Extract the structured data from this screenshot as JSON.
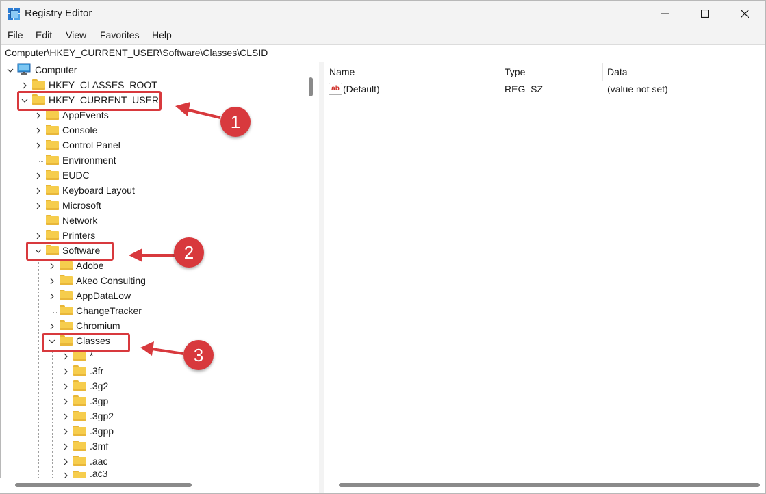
{
  "window": {
    "title": "Registry Editor",
    "minimize_icon": "minimize-icon",
    "maximize_icon": "maximize-icon",
    "close_icon": "close-icon"
  },
  "menu": [
    "File",
    "Edit",
    "View",
    "Favorites",
    "Help"
  ],
  "address": "Computer\\HKEY_CURRENT_USER\\Software\\Classes\\CLSID",
  "tree": {
    "root": "Computer",
    "hkcr": "HKEY_CLASSES_ROOT",
    "hkcu": "HKEY_CURRENT_USER",
    "hkcu_children": [
      "AppEvents",
      "Console",
      "Control Panel",
      "Environment",
      "EUDC",
      "Keyboard Layout",
      "Microsoft",
      "Network",
      "Printers"
    ],
    "software": "Software",
    "software_children": [
      "Adobe",
      "Akeo Consulting",
      "AppDataLow",
      "ChangeTracker",
      "Chromium"
    ],
    "classes": "Classes",
    "classes_children": [
      "*",
      ".3fr",
      ".3g2",
      ".3gp",
      ".3gp2",
      ".3gpp",
      ".3mf",
      ".aac",
      ".ac3"
    ]
  },
  "list": {
    "headers": [
      "Name",
      "Type",
      "Data"
    ],
    "rows": [
      {
        "name": "(Default)",
        "type": "REG_SZ",
        "data": "(value not set)"
      }
    ]
  },
  "annotations": [
    "1",
    "2",
    "3"
  ],
  "colors": {
    "annotation_red": "#d8393d",
    "folder_yellow": "#f6cd4d",
    "window_bg": "#f3f3f3"
  }
}
